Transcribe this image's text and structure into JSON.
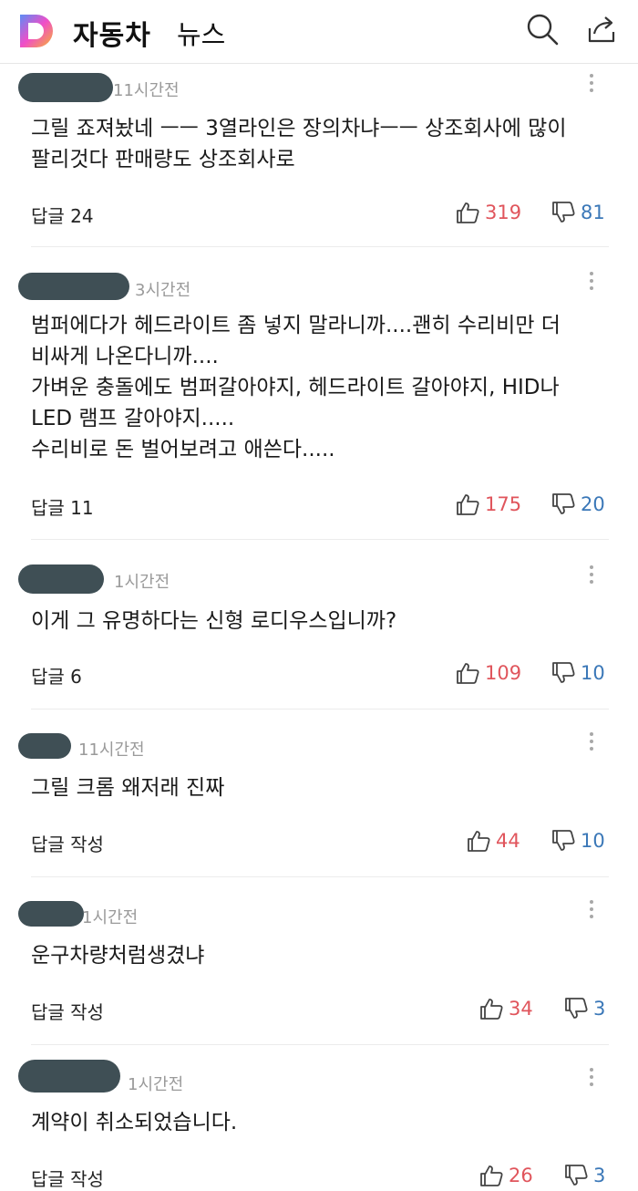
{
  "header": {
    "app_title": "자동차",
    "section_title": "뉴스",
    "logo_letter": "D",
    "icons": [
      "search-icon",
      "share-icon"
    ]
  },
  "colors": {
    "like": "#e0555c",
    "dislike": "#3b78b8",
    "logo_gradient": [
      "#5b8df5",
      "#f04ec8",
      "#f7b230"
    ]
  },
  "comments": [
    {
      "time": "11시간전",
      "lines": [
        "그릴 죠져놨네 ㅡㅡ 3열라인은 장의차냐ㅡㅡ 상조회사에 많이",
        "팔리것다 판매량도 상조회사로"
      ],
      "reply_label": "답글 24",
      "likes": "319",
      "dislikes": "81"
    },
    {
      "time": "3시간전",
      "lines": [
        "범퍼에다가 헤드라이트 좀 넣지 말라니까....괜히 수리비만 더",
        "비싸게 나온다니까....",
        "가벼운 충돌에도 범퍼갈아야지, 헤드라이트 갈아야지, HID나",
        "LED 램프 갈아야지.....",
        "수리비로 돈 벌어보려고 애쓴다....."
      ],
      "reply_label": "답글 11",
      "likes": "175",
      "dislikes": "20"
    },
    {
      "time": "1시간전",
      "lines": [
        "이게 그 유명하다는 신형 로디우스입니까?"
      ],
      "reply_label": "답글 6",
      "likes": "109",
      "dislikes": "10"
    },
    {
      "time": "11시간전",
      "lines": [
        "그릴 크롬 왜저래 진짜"
      ],
      "reply_label": "답글 작성",
      "likes": "44",
      "dislikes": "10"
    },
    {
      "time": "1시간전",
      "lines": [
        "운구차량처럼생겼냐"
      ],
      "reply_label": "답글 작성",
      "likes": "34",
      "dislikes": "3"
    },
    {
      "time": "1시간전",
      "lines": [
        "계약이 취소되었습니다."
      ],
      "reply_label": "답글 작성",
      "likes": "26",
      "dislikes": "3"
    }
  ]
}
